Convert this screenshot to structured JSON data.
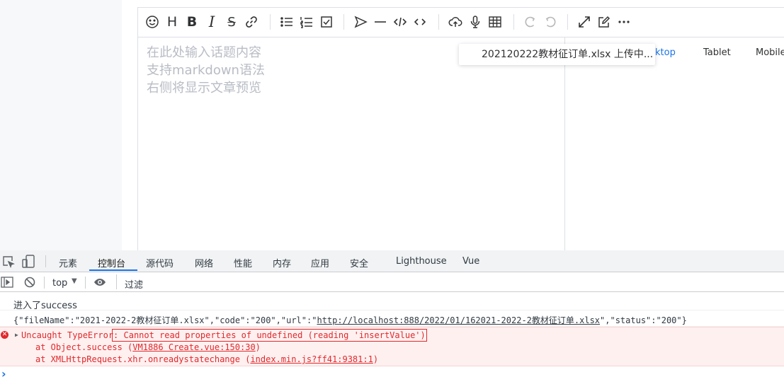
{
  "editor": {
    "placeholder_lines": [
      "在此处输入话题内容",
      "支持markdown语法",
      "右侧将显示文章预览"
    ],
    "toolbar_icons": [
      "emoji-icon",
      "heading-icon",
      "bold-icon",
      "italic-icon",
      "strikethrough-icon",
      "link-icon",
      "unordered-list-icon",
      "ordered-list-icon",
      "checklist-icon",
      "quote-icon",
      "horizontal-rule-icon",
      "code-icon",
      "inline-code-icon",
      "upload-icon",
      "record-icon",
      "table-icon",
      "undo-icon",
      "redo-icon",
      "fullscreen-icon",
      "edit-mode-icon",
      "more-icon"
    ],
    "preview_tabs": [
      "ktop",
      "Tablet",
      "Mobile"
    ],
    "upload_tip": "202120222教材征订单.xlsx 上传中..."
  },
  "devtools": {
    "tabs": [
      "元素",
      "控制台",
      "源代码",
      "网络",
      "性能",
      "内存",
      "应用",
      "安全",
      "Lighthouse",
      "Vue"
    ],
    "active_tab": "控制台",
    "context": "top",
    "filter_placeholder": "过滤",
    "console": {
      "log1": "进入了success",
      "log2_prefix": "{\"fileName\":\"2021-2022-2教材征订单.xlsx\",\"code\":\"200\",\"url\":\"",
      "log2_url": "http://localhost:888/2022/01/162021-2022-2教材征订单.xlsx",
      "log2_suffix": "\",\"status\":\"200\"}",
      "error_head": "Uncaught TypeError",
      "error_msg": ": Cannot read properties of undefined (reading 'insertValue')",
      "stack1_prefix": "at Object.success (",
      "stack1_link": "VM1886 Create.vue:150:30",
      "stack1_suffix": ")",
      "stack2_prefix": "at XMLHttpRequest.xhr.onreadystatechange (",
      "stack2_link": "index.min.js?ff41:9381:1",
      "stack2_suffix": ")",
      "prompt": "›"
    },
    "colors": {
      "error": "#e0292c",
      "error_bg": "#fff0f0",
      "active_tab": "#1a73e8"
    }
  }
}
